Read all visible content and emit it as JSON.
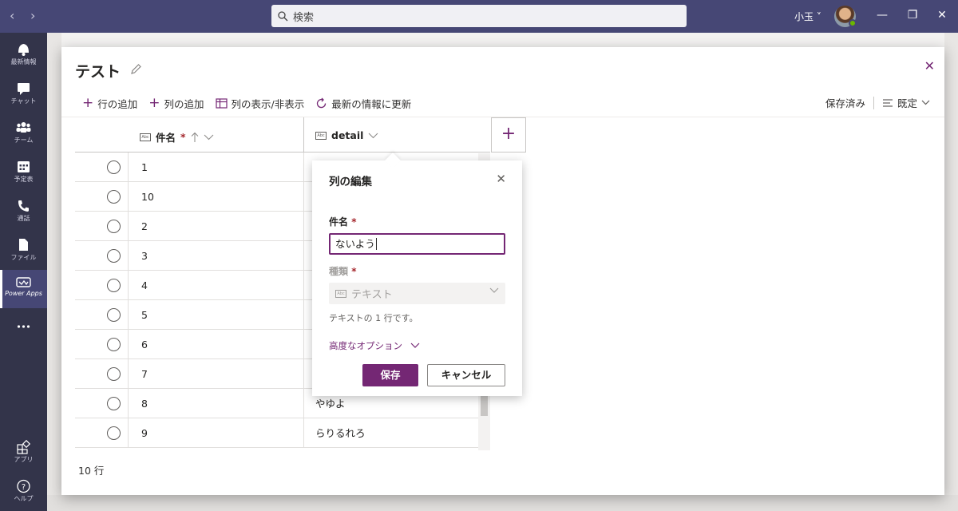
{
  "titlebar": {
    "back": "‹",
    "forward": "›",
    "search_placeholder": "検索",
    "user": "小玉 ˅",
    "minimize": "—",
    "restore": "❐",
    "close": "✕"
  },
  "rail": [
    {
      "label": "最新情報",
      "icon": "bell-icon"
    },
    {
      "label": "チャット",
      "icon": "chat-icon"
    },
    {
      "label": "チーム",
      "icon": "teams-icon"
    },
    {
      "label": "予定表",
      "icon": "calendar-icon"
    },
    {
      "label": "通話",
      "icon": "phone-icon"
    },
    {
      "label": "ファイル",
      "icon": "file-icon"
    },
    {
      "label": "Power Apps",
      "icon": "powerapps-icon",
      "active": true
    },
    {
      "label": "",
      "icon": "more-icon"
    },
    {
      "label": "アプリ",
      "icon": "apps-icon"
    },
    {
      "label": "ヘルプ",
      "icon": "help-icon"
    }
  ],
  "modal": {
    "title": "テスト",
    "close": "✕",
    "commands": [
      {
        "label": "行の追加",
        "icon": "plus-icon"
      },
      {
        "label": "列の追加",
        "icon": "plus-icon"
      },
      {
        "label": "列の表示/非表示",
        "icon": "columns-icon"
      },
      {
        "label": "最新の情報に更新",
        "icon": "refresh-icon"
      }
    ],
    "status": "保存済み",
    "view": "既定"
  },
  "grid": {
    "columns": [
      {
        "label": "件名",
        "required": "*"
      },
      {
        "label": "detail"
      }
    ],
    "rows": [
      {
        "a": "1",
        "b": ""
      },
      {
        "a": "10",
        "b": ""
      },
      {
        "a": "2",
        "b": ""
      },
      {
        "a": "3",
        "b": ""
      },
      {
        "a": "4",
        "b": ""
      },
      {
        "a": "5",
        "b": ""
      },
      {
        "a": "6",
        "b": ""
      },
      {
        "a": "7",
        "b": ""
      },
      {
        "a": "8",
        "b": "やゆよ"
      },
      {
        "a": "9",
        "b": "らりるれろ"
      }
    ],
    "row_count": "10 行"
  },
  "popup": {
    "title": "列の編集",
    "name_label": "件名",
    "name_value": "ないよう",
    "type_label": "種類",
    "type_value": "テキスト",
    "hint": "テキストの 1 行です。",
    "advanced": "高度なオプション",
    "save": "保存",
    "cancel": "キャンセル",
    "required_mark": "*"
  },
  "colors": {
    "accent": "#742774",
    "titlebar": "#464775",
    "rail": "#33344a"
  }
}
